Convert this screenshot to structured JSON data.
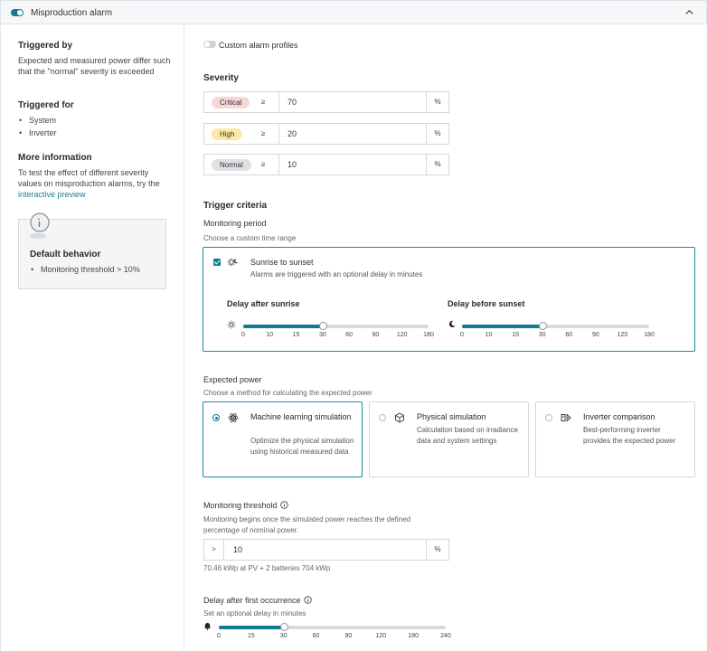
{
  "header": {
    "title": "Misproduction alarm"
  },
  "left": {
    "triggered_by_title": "Triggered by",
    "triggered_by_text": "Expected and measured power differ such that the \"normal\" severity is exceeded",
    "triggered_for_title": "Triggered for",
    "triggered_for_items": [
      "System",
      "Inverter"
    ],
    "more_info_title": "More information",
    "more_info_text": "To test the effect of different severity values on misproduction alarms, try the ",
    "more_info_link": "interactive preview",
    "default_title": "Default behavior",
    "default_item": "Monitoring threshold > 10%"
  },
  "custom_profiles_label": "Custom alarm profiles",
  "severity": {
    "title": "Severity",
    "rows": [
      {
        "label": "Critical",
        "op": "≥",
        "value": "70",
        "unit": "%",
        "color": "#f8d7d7"
      },
      {
        "label": "High",
        "op": "≥",
        "value": "20",
        "unit": "%",
        "color": "#fbe9a6"
      },
      {
        "label": "Normal",
        "op": "≥",
        "value": "10",
        "unit": "%",
        "color": "#dfe1e4"
      }
    ]
  },
  "trigger": {
    "title": "Trigger criteria",
    "period_label": "Monitoring period",
    "period_hint": "Choose a custom time range",
    "option_title": "Sunrise to sunset",
    "option_desc": "Alarms are triggered with an optional delay in minutes",
    "sunrise_label": "Delay after sunrise",
    "sunset_label": "Delay before sunset",
    "sunrise_ticks": [
      "0",
      "10",
      "15",
      "30",
      "60",
      "90",
      "120",
      "180"
    ],
    "sunset_ticks": [
      "0",
      "10",
      "15",
      "30",
      "60",
      "90",
      "120",
      "180"
    ],
    "sunrise_value_index": 3,
    "sunset_value_index": 3
  },
  "expected": {
    "label": "Expected power",
    "hint": "Choose a method for calculating the expected power",
    "cards": [
      {
        "title": "Machine learning simulation",
        "desc": "Optimize the physical simulation using historical measured data",
        "selected": true,
        "icon": "atom-icon"
      },
      {
        "title": "Physical simulation",
        "desc": "Calculation based on irradiance data and system settings",
        "selected": false,
        "icon": "cube-icon"
      },
      {
        "title": "Inverter comparison",
        "desc": "Best-performing inverter provides the expected power",
        "selected": false,
        "icon": "inverter-icon"
      }
    ]
  },
  "threshold": {
    "label": "Monitoring threshold",
    "hint": "Monitoring begins once the simulated power reaches the defined percentage of nominal power.",
    "op": ">",
    "value": "10",
    "unit": "%",
    "note": "70.46 kWp at PV + 2 batteries 704 kWp"
  },
  "delay": {
    "label": "Delay after first occurrence",
    "hint": "Set an optional delay in minutes",
    "ticks": [
      "0",
      "15",
      "30",
      "60",
      "90",
      "120",
      "180",
      "240"
    ],
    "value_index": 2
  },
  "colors": {
    "accent": "#0f7c91",
    "track": "#d9dcdf"
  }
}
